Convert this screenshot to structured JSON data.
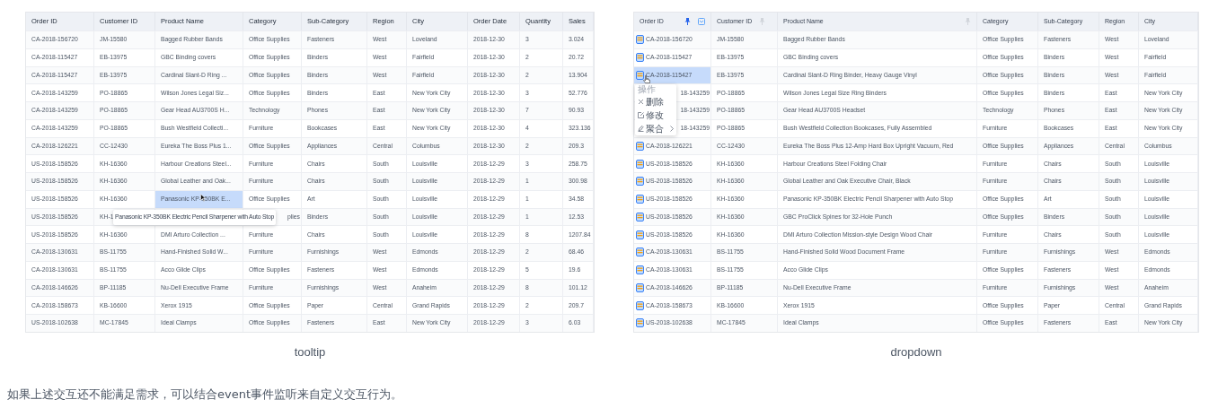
{
  "panels": [
    {
      "caption": "tooltip",
      "table": {
        "columns": [
          {
            "label": "Order ID"
          },
          {
            "label": "Customer ID"
          },
          {
            "label": "Product Name"
          },
          {
            "label": "Category"
          },
          {
            "label": "Sub-Category"
          },
          {
            "label": "Region"
          },
          {
            "label": "City"
          },
          {
            "label": "Order Date"
          },
          {
            "label": "Quantity"
          },
          {
            "label": "Sales"
          }
        ],
        "rows": [
          {
            "cells": [
              "CA-2018-156720",
              "JM-15580",
              "Bagged Rubber Bands",
              "Office Supplies",
              "Fasteners",
              "West",
              "Loveland",
              "2018-12-30",
              "3",
              "3.024"
            ]
          },
          {
            "cells": [
              "CA-2018-115427",
              "EB-13975",
              "GBC Binding covers",
              "Office Supplies",
              "Binders",
              "West",
              "Fairfield",
              "2018-12-30",
              "2",
              "20.72"
            ]
          },
          {
            "cells": [
              "CA-2018-115427",
              "EB-13975",
              "Cardinal Slant-D Ring ...",
              "Office Supplies",
              "Binders",
              "West",
              "Fairfield",
              "2018-12-30",
              "2",
              "13.904"
            ]
          },
          {
            "cells": [
              "CA-2018-143259",
              "PO-18865",
              "Wilson Jones Legal Siz...",
              "Office Supplies",
              "Binders",
              "East",
              "New York City",
              "2018-12-30",
              "3",
              "52.776"
            ]
          },
          {
            "cells": [
              "CA-2018-143259",
              "PO-18865",
              "Gear Head AU3700S H...",
              "Technology",
              "Phones",
              "East",
              "New York City",
              "2018-12-30",
              "7",
              "90.93"
            ]
          },
          {
            "cells": [
              "CA-2018-143259",
              "PO-18865",
              "Bush Westfield Collecti...",
              "Furniture",
              "Bookcases",
              "East",
              "New York City",
              "2018-12-30",
              "4",
              "323.136"
            ]
          },
          {
            "cells": [
              "CA-2018-126221",
              "CC-12430",
              "Eureka The Boss Plus 1...",
              "Office Supplies",
              "Appliances",
              "Central",
              "Columbus",
              "2018-12-30",
              "2",
              "209.3"
            ]
          },
          {
            "cells": [
              "US-2018-158526",
              "KH-16360",
              "Harbour Creations Steel...",
              "Furniture",
              "Chairs",
              "South",
              "Louisville",
              "2018-12-29",
              "3",
              "258.75"
            ]
          },
          {
            "cells": [
              "US-2018-158526",
              "KH-16360",
              "Global Leather and Oak...",
              "Furniture",
              "Chairs",
              "South",
              "Louisville",
              "2018-12-29",
              "1",
              "300.98"
            ]
          },
          {
            "cells": [
              "US-2018-158526",
              "KH-16360",
              {
                "text": "Panasonic KP-350BK E...",
                "selected": true,
                "cursor": true
              },
              "Office Supplies",
              "Art",
              "South",
              "Louisville",
              "2018-12-29",
              "1",
              "34.58"
            ]
          },
          {
            "tooltip": "Panasonic KP-350BK Electric Pencil Sharpener with Auto Stop",
            "cells": [
              "US-2018-158526",
              "KH-1",
              null,
              {
                "text": "plies",
                "cut": true
              },
              "Binders",
              "South",
              "Louisville",
              "2018-12-29",
              "1",
              "12.53"
            ]
          },
          {
            "cells": [
              "US-2018-158526",
              "KH-16360",
              "DMI Arturo Collection ...",
              "Furniture",
              "Chairs",
              "South",
              "Louisville",
              "2018-12-29",
              "8",
              "1207.84"
            ]
          },
          {
            "cells": [
              "CA-2018-130631",
              "BS-11755",
              "Hand-Finished Solid W...",
              "Furniture",
              "Furnishings",
              "West",
              "Edmonds",
              "2018-12-29",
              "2",
              "68.46"
            ]
          },
          {
            "cells": [
              "CA-2018-130631",
              "BS-11755",
              "Acco Glide Clips",
              "Office Supplies",
              "Fasteners",
              "West",
              "Edmonds",
              "2018-12-29",
              "5",
              "19.6"
            ]
          },
          {
            "cells": [
              "CA-2018-146626",
              "BP-11185",
              "Nu-Dell Executive Frame",
              "Furniture",
              "Furnishings",
              "West",
              "Anaheim",
              "2018-12-29",
              "8",
              "101.12"
            ]
          },
          {
            "cells": [
              "CA-2018-158673",
              "KB-16600",
              "Xerox 1915",
              "Office Supplies",
              "Paper",
              "Central",
              "Grand Rapids",
              "2018-12-29",
              "2",
              "209.7"
            ]
          },
          {
            "cells": [
              "US-2018-102638",
              "MC-17845",
              "Ideal Clamps",
              "Office Supplies",
              "Fasteners",
              "East",
              "New York City",
              "2018-12-29",
              "3",
              "6.03"
            ]
          }
        ]
      }
    },
    {
      "caption": "dropdown",
      "table": {
        "columns": [
          {
            "label": "Order ID",
            "pinned": true,
            "filter": true
          },
          {
            "label": "Customer ID",
            "pinned": false,
            "filter": false
          },
          {
            "label": "Product Name",
            "pinned": false,
            "filter": false
          },
          {
            "label": "Category"
          },
          {
            "label": "Sub-Category"
          },
          {
            "label": "Region"
          },
          {
            "label": "City"
          }
        ],
        "rows": [
          {
            "cells": [
              "CA-2018-156720",
              "JM-15580",
              "Bagged Rubber Bands",
              "Office Supplies",
              "Fasteners",
              "West",
              "Loveland"
            ]
          },
          {
            "cells": [
              "CA-2018-115427",
              "EB-13975",
              "GBC Binding covers",
              "Office Supplies",
              "Binders",
              "West",
              "Fairfield"
            ]
          },
          {
            "menu": {
              "title": "操作",
              "items": [
                {
                  "label": "删除",
                  "submenu": false
                },
                {
                  "label": "修改",
                  "submenu": false
                },
                {
                  "label": "聚合",
                  "submenu": true
                }
              ]
            },
            "cells": [
              {
                "text": "CA-2018-115427",
                "selected": true,
                "cursor": true
              },
              "EB-13975",
              "Cardinal Slant-D Ring Binder, Heavy Gauge Vinyl",
              "Office Supplies",
              "Binders",
              "West",
              "Fairfield"
            ]
          },
          {
            "cells": [
              {
                "text": "18-143259",
                "cut": true
              },
              "PO-18865",
              "Wilson Jones Legal Size Ring Binders",
              "Office Supplies",
              "Binders",
              "East",
              "New York City"
            ]
          },
          {
            "cells": [
              {
                "text": "18-143259",
                "cut": true
              },
              "PO-18865",
              "Gear Head AU3700S Headset",
              "Technology",
              "Phones",
              "East",
              "New York City"
            ]
          },
          {
            "cells": [
              {
                "text": "18-143259",
                "cut": true
              },
              "PO-18865",
              "Bush Westfield Collection Bookcases, Fully Assembled",
              "Furniture",
              "Bookcases",
              "East",
              "New York City"
            ]
          },
          {
            "cells": [
              "CA-2018-126221",
              "CC-12430",
              "Eureka The Boss Plus 12-Amp Hard Box Upright Vacuum, Red",
              "Office Supplies",
              "Appliances",
              "Central",
              "Columbus"
            ]
          },
          {
            "cells": [
              "US-2018-158526",
              "KH-16360",
              "Harbour Creations Steel Folding Chair",
              "Furniture",
              "Chairs",
              "South",
              "Louisville"
            ]
          },
          {
            "cells": [
              "US-2018-158526",
              "KH-16360",
              "Global Leather and Oak Executive Chair, Black",
              "Furniture",
              "Chairs",
              "South",
              "Louisville"
            ]
          },
          {
            "cells": [
              "US-2018-158526",
              "KH-16360",
              "Panasonic KP-350BK Electric Pencil Sharpener with Auto Stop",
              "Office Supplies",
              "Art",
              "South",
              "Louisville"
            ]
          },
          {
            "cells": [
              "US-2018-158526",
              "KH-16360",
              "GBC ProClick Spines for 32-Hole Punch",
              "Office Supplies",
              "Binders",
              "South",
              "Louisville"
            ]
          },
          {
            "cells": [
              "US-2018-158526",
              "KH-16360",
              "DMI Arturo Collection Mission-style Design Wood Chair",
              "Furniture",
              "Chairs",
              "South",
              "Louisville"
            ]
          },
          {
            "cells": [
              "CA-2018-130631",
              "BS-11755",
              "Hand-Finished Solid Wood Document Frame",
              "Furniture",
              "Furnishings",
              "West",
              "Edmonds"
            ]
          },
          {
            "cells": [
              "CA-2018-130631",
              "BS-11755",
              "Acco Glide Clips",
              "Office Supplies",
              "Fasteners",
              "West",
              "Edmonds"
            ]
          },
          {
            "cells": [
              "CA-2018-146626",
              "BP-11185",
              "Nu-Dell Executive Frame",
              "Furniture",
              "Furnishings",
              "West",
              "Anaheim"
            ]
          },
          {
            "cells": [
              "CA-2018-158673",
              "KB-16600",
              "Xerox 1915",
              "Office Supplies",
              "Paper",
              "Central",
              "Grand Rapids"
            ]
          },
          {
            "cells": [
              "US-2018-102638",
              "MC-17845",
              "Ideal Clamps",
              "Office Supplies",
              "Fasteners",
              "East",
              "New York City"
            ]
          }
        ]
      }
    }
  ],
  "note": "如果上述交互还不能满足需求，可以结合event事件监听来自定义交互行为。"
}
